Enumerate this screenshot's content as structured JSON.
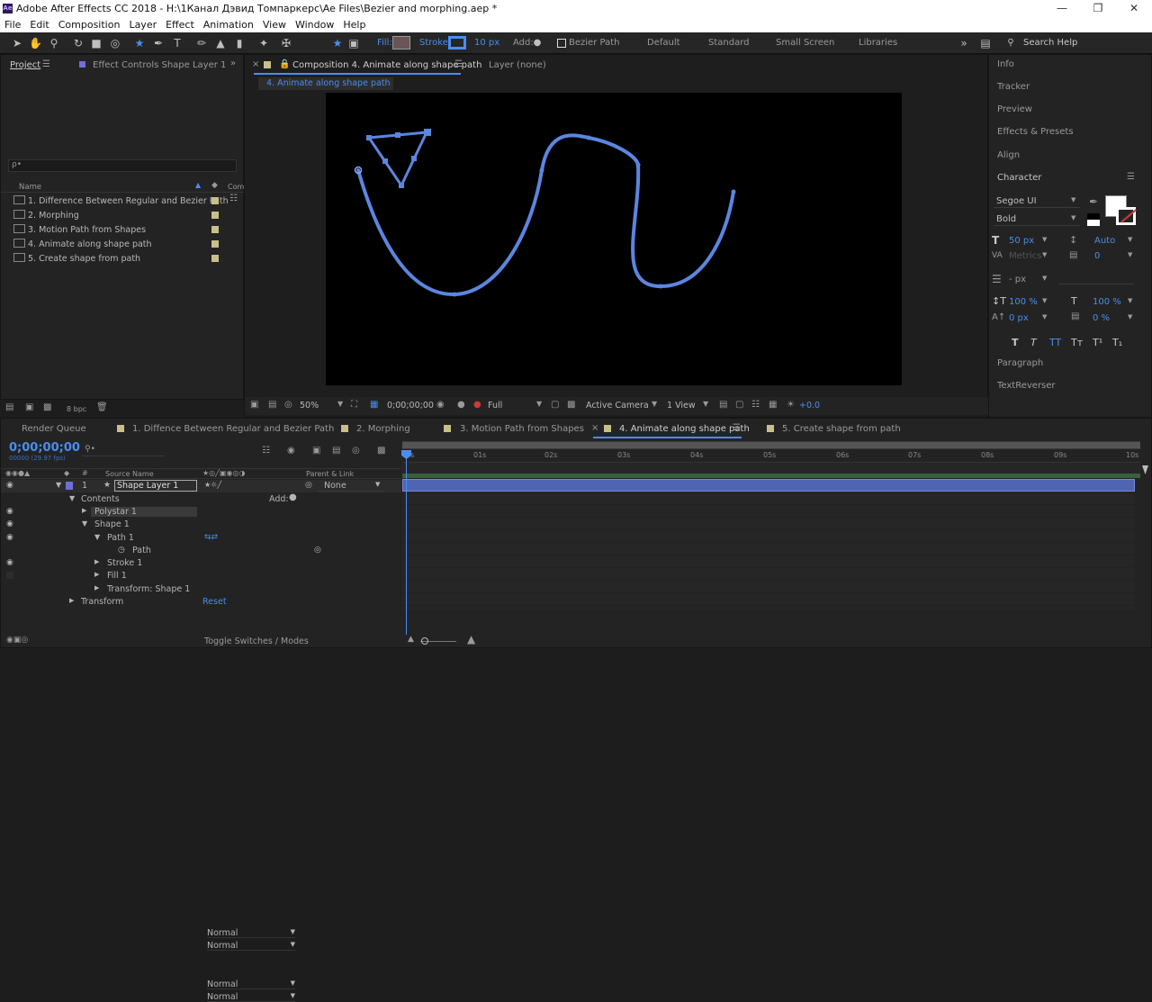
{
  "window": {
    "title": "Adobe After Effects CC 2018 - H:\\1Канал Дэвид Томпаркерс\\Ae Files\\Bezier and morphing.aep *",
    "logo": "Ae"
  },
  "menu": [
    "File",
    "Edit",
    "Composition",
    "Layer",
    "Effect",
    "Animation",
    "View",
    "Window",
    "Help"
  ],
  "toolbar": {
    "fill_label": "Fill:",
    "stroke_label": "Stroke:",
    "stroke_width": "10 px",
    "add_label": "Add:",
    "bezier_label": "Bezier Path",
    "workspaces": [
      "Default",
      "Standard",
      "Small Screen",
      "Libraries"
    ],
    "search_placeholder": "Search Help",
    "stroke_color": "#4a8df0",
    "fill_color": "#6b5456"
  },
  "project_panel": {
    "tab": "Project",
    "effect_controls": "Effect Controls Shape Layer 1",
    "search_placeholder": "ρ•",
    "col_name": "Name",
    "col_comment": "Com",
    "items": [
      "1. Difference Between Regular and Bezier Path",
      "2. Morphing",
      "3. Motion Path from Shapes",
      "4. Animate along shape path",
      "5. Create shape from path"
    ],
    "bpc": "8 bpc"
  },
  "composition_panel": {
    "tab": "Composition 4. Animate along shape path",
    "layer_tab": "Layer (none)",
    "breadcrumb": "4. Animate along shape path",
    "zoom": "50%",
    "timecode": "0;00;00;00",
    "resolution": "Full",
    "camera": "Active Camera",
    "views": "1 View",
    "exposure": "+0.0",
    "path_color": "#5b86e0"
  },
  "right_panel": {
    "sections": [
      "Info",
      "Tracker",
      "Preview",
      "Effects & Presets",
      "Align"
    ],
    "character_title": "Character",
    "font": "Segoe UI",
    "style": "Bold",
    "size": "50 px",
    "leading": "Auto",
    "kerning": "Metrics",
    "tracking": "0",
    "stroke_w": "- px",
    "vscale": "100 %",
    "hscale": "100 %",
    "baseline": "0 px",
    "tsume": "0 %",
    "type_buttons": [
      "T",
      "T",
      "TT",
      "Tт",
      "T¹",
      "T₁"
    ],
    "paragraph": "Paragraph",
    "textreverser": "TextReverser"
  },
  "timeline": {
    "tabs": [
      "Render Queue",
      "1. Diffence Between Regular and Bezier Path",
      "2. Morphing",
      "3. Motion Path from Shapes",
      "4. Animate along shape path",
      "5. Create shape from path"
    ],
    "timecode": "0;00;00;00",
    "fps": "00000 (29.97 fps)",
    "source_name": "Source Name",
    "parent_link": "Parent & Link",
    "layer_num": "1",
    "layer_name": "Shape Layer 1",
    "parent_value": "None",
    "contents": "Contents",
    "add": "Add:",
    "polystar": "Polystar 1",
    "shape": "Shape 1",
    "path_group": "Path 1",
    "path": "Path",
    "stroke": "Stroke 1",
    "fill": "Fill 1",
    "transform_shape": "Transform: Shape 1",
    "transform": "Transform",
    "reset": "Reset",
    "mode_normal": "Normal",
    "ruler": [
      "0s",
      "01s",
      "02s",
      "03s",
      "04s",
      "05s",
      "06s",
      "07s",
      "08s",
      "09s",
      "10s"
    ],
    "toggle": "Toggle Switches / Modes",
    "layer_bar_color": "#5064b4"
  }
}
